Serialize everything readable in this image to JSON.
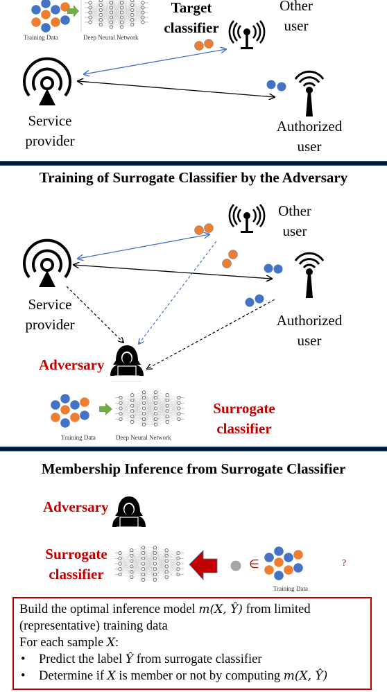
{
  "section1": {
    "training_data_caption": "Training Data",
    "dnn_caption": "Deep Neural Network",
    "target_classifier": [
      "Target",
      "classifier"
    ],
    "other_user": [
      "Other",
      "user"
    ],
    "service_provider": [
      "Service",
      "provider"
    ],
    "authorized_user": [
      "Authorized",
      "user"
    ]
  },
  "section2": {
    "heading": "Training of Surrogate Classifier by the Adversary",
    "other_user": [
      "Other",
      "user"
    ],
    "service_provider": [
      "Service",
      "provider"
    ],
    "authorized_user": [
      "Authorized",
      "user"
    ],
    "adversary": "Adversary",
    "training_data_caption": "Training Data",
    "dnn_caption": "Deep Neural Network",
    "surrogate_classifier": [
      "Surrogate",
      "classifier"
    ]
  },
  "section3": {
    "heading": "Membership Inference from Surrogate Classifier",
    "adversary": "Adversary",
    "surrogate_classifier": [
      "Surrogate",
      "classifier"
    ],
    "element_of_symbol": "∈",
    "question_mark": "?",
    "training_data_caption": "Training Data",
    "box": {
      "line1_pre": "Build the optimal inference model ",
      "line1_math": "m(X, Ŷ)",
      "line1_post": " from limited",
      "line2": "(representative) training data",
      "line3_pre": "For each sample ",
      "line3_math": "X",
      "line3_post": ":",
      "bullet1_pre": "Predict the label ",
      "bullet1_math": "Ŷ",
      "bullet1_post": " from surrogate classifier",
      "bullet2_pre": "Determine if ",
      "bullet2_math1": "X",
      "bullet2_mid": " is member or not by computing ",
      "bullet2_math2": "m(X, Ŷ)"
    }
  },
  "colors": {
    "blue_dot": "#4472c4",
    "orange_dot": "#ed7d31",
    "gray_dot": "#a6a6a6",
    "accent_red": "#c00000",
    "arrow_green": "#70ad47",
    "link_blue": "#4472c4",
    "separator": "#07152b"
  }
}
